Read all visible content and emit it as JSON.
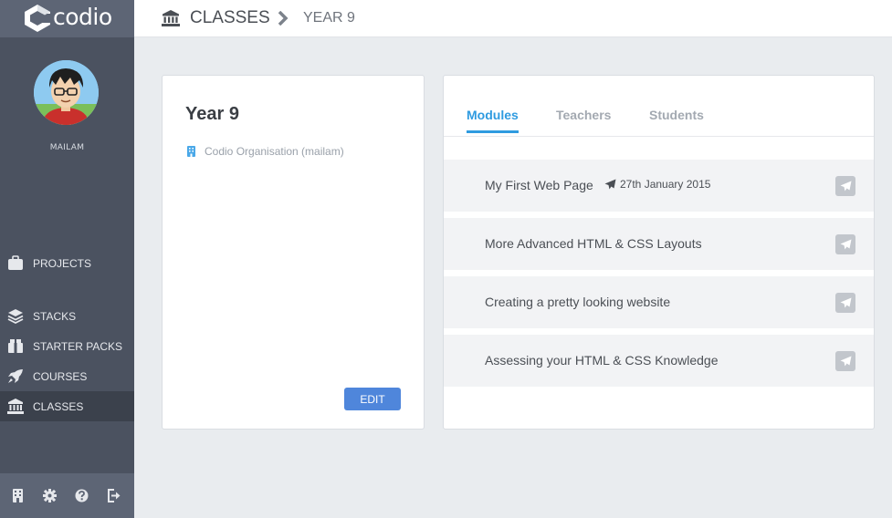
{
  "app": {
    "logo_text": "codio"
  },
  "sidebar": {
    "username": "MAILAM",
    "nav": [
      {
        "label": "PROJECTS",
        "icon": "briefcase-icon"
      },
      {
        "label": "STACKS",
        "icon": "layers-icon"
      },
      {
        "label": "STARTER PACKS",
        "icon": "box-icon"
      },
      {
        "label": "COURSES",
        "icon": "rocket-icon"
      },
      {
        "label": "CLASSES",
        "icon": "institution-icon",
        "active": true
      }
    ],
    "footer_icons": [
      "building-icon",
      "gear-icon",
      "help-icon",
      "logout-icon"
    ]
  },
  "breadcrumb": {
    "root": "CLASSES",
    "current": "YEAR 9"
  },
  "class_card": {
    "title": "Year 9",
    "organisation": "Codio Organisation (mailam)",
    "edit_label": "EDIT"
  },
  "tabs": [
    {
      "label": "Modules",
      "active": true
    },
    {
      "label": "Teachers"
    },
    {
      "label": "Students"
    }
  ],
  "modules": [
    {
      "title": "My First Web Page",
      "published": "27th January 2015"
    },
    {
      "title": "More Advanced HTML & CSS Layouts"
    },
    {
      "title": "Creating a pretty looking website"
    },
    {
      "title": "Assessing your HTML & CSS Knowledge"
    }
  ],
  "colors": {
    "sidebar": "#4b5260",
    "accent": "#2f9be0",
    "edit_button": "#4f86db"
  }
}
